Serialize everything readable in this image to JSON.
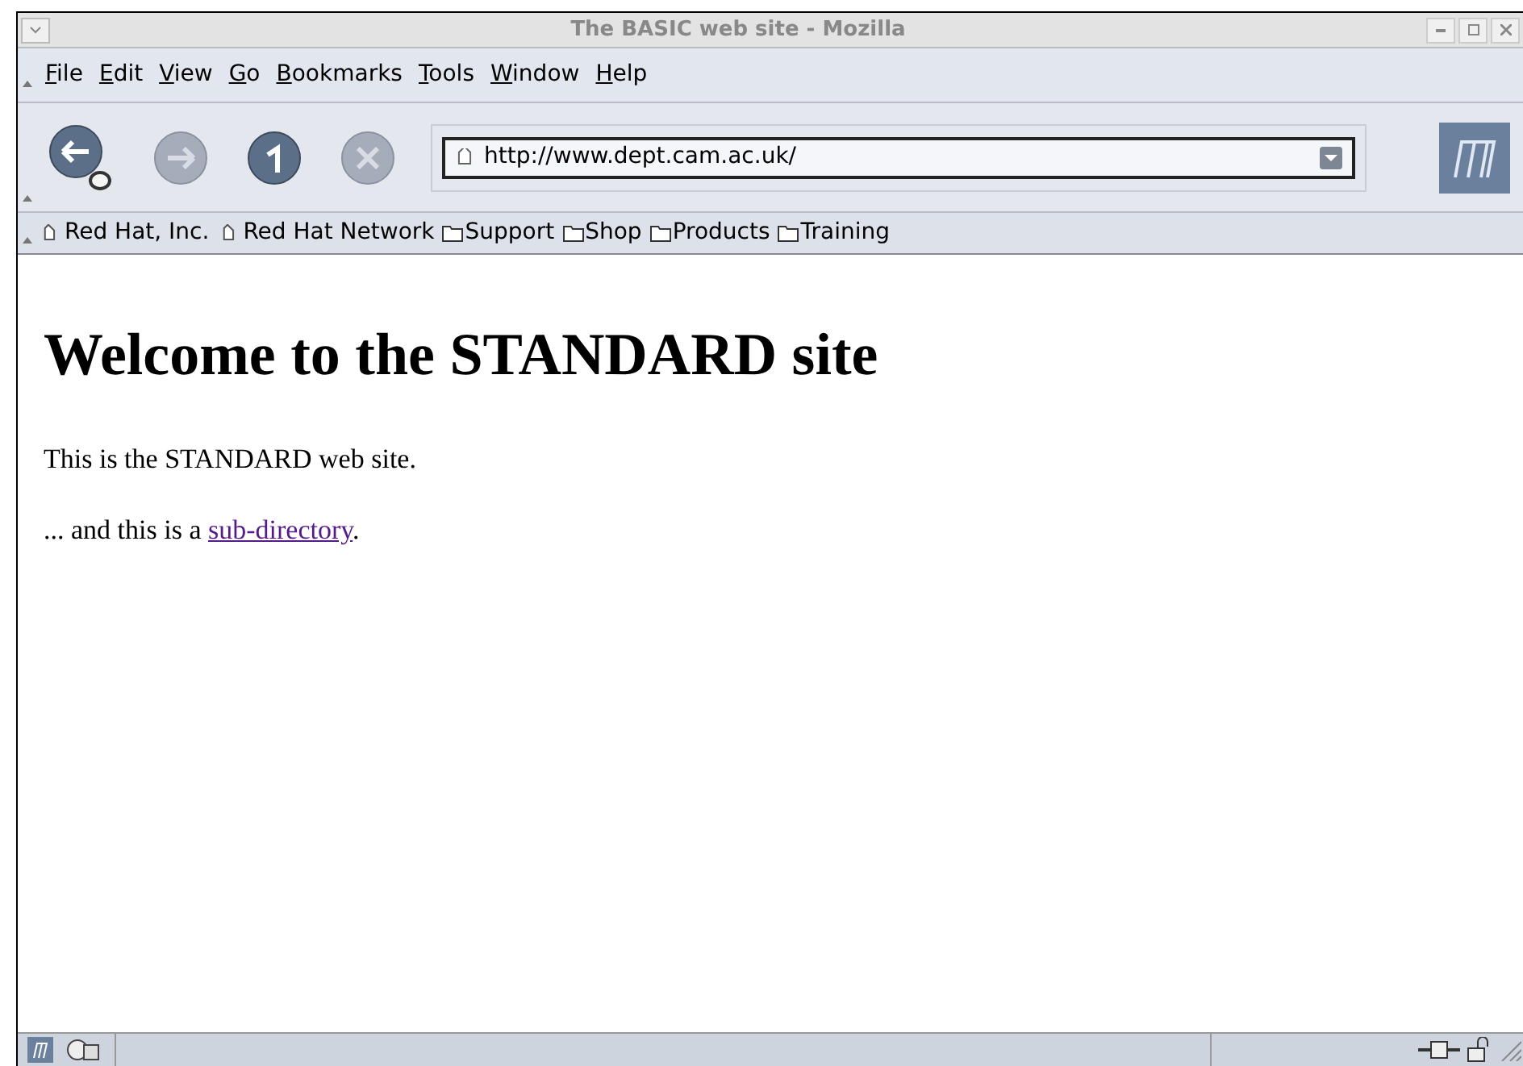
{
  "window": {
    "title": "The BASIC web site - Mozilla"
  },
  "menu": [
    "File",
    "Edit",
    "View",
    "Go",
    "Bookmarks",
    "Tools",
    "Window",
    "Help"
  ],
  "toolbar": {
    "url": "http://www.dept.cam.ac.uk/"
  },
  "bookmarks": [
    {
      "label": "Red Hat, Inc.",
      "kind": "link"
    },
    {
      "label": "Red Hat Network",
      "kind": "link"
    },
    {
      "label": "Support",
      "kind": "folder"
    },
    {
      "label": "Shop",
      "kind": "folder"
    },
    {
      "label": "Products",
      "kind": "folder"
    },
    {
      "label": "Training",
      "kind": "folder"
    }
  ],
  "page": {
    "heading": "Welcome to the STANDARD site",
    "paragraph": "This is the STANDARD web site.",
    "link_prefix": "... and this is a ",
    "link": "sub-directory",
    "link_suffix": "."
  }
}
